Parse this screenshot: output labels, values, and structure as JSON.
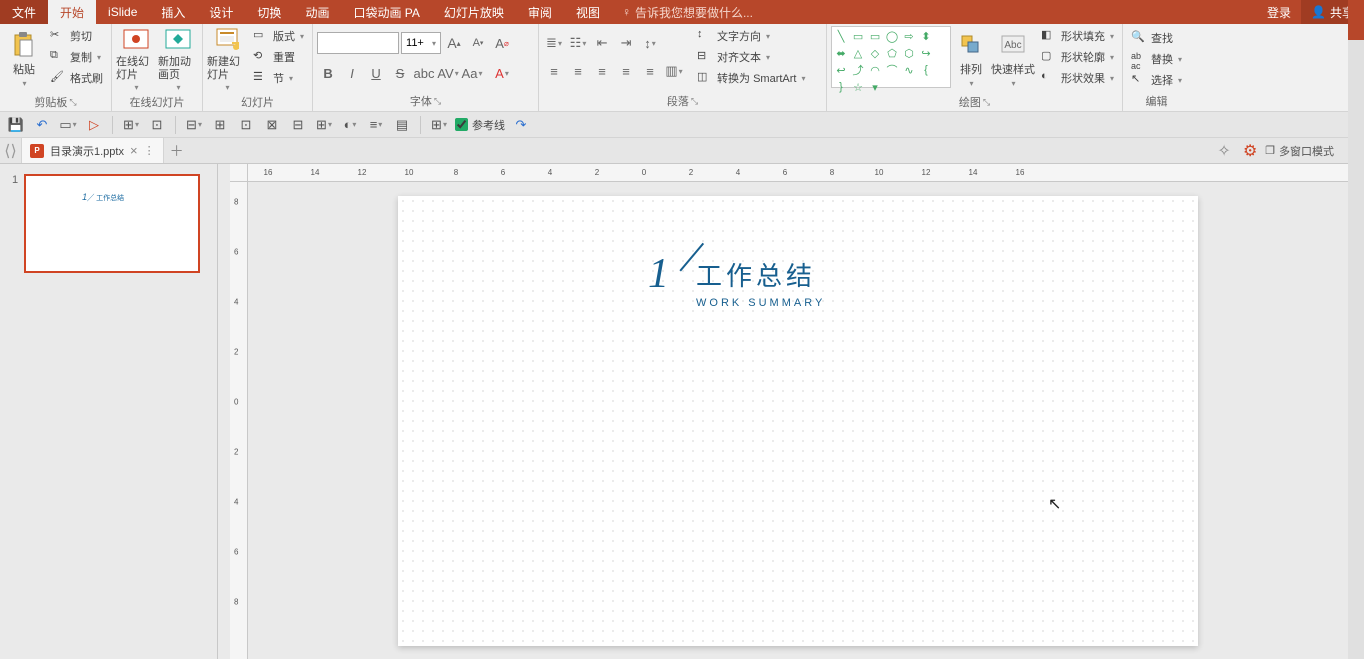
{
  "tabs": {
    "file": "文件",
    "home": "开始",
    "islide": "iSlide",
    "insert": "插入",
    "design": "设计",
    "transition": "切换",
    "animation": "动画",
    "pocket": "口袋动画 PA",
    "slideshow": "幻灯片放映",
    "review": "审阅",
    "view": "视图"
  },
  "tell_me": "告诉我您想要做什么...",
  "title_right": {
    "login": "登录",
    "share": "共享"
  },
  "ribbon": {
    "clipboard": {
      "paste": "粘贴",
      "cut": "剪切",
      "copy": "复制",
      "format_painter": "格式刷",
      "label": "剪贴板"
    },
    "online_slides": {
      "online": "在线幻灯片",
      "new_anim": "新加动画页",
      "label": "在线幻灯片"
    },
    "slides": {
      "new_slide": "新建幻灯片",
      "layout": "版式",
      "reset": "重置",
      "section": "节",
      "label": "幻灯片"
    },
    "font": {
      "size_value": "11+",
      "label": "字体"
    },
    "paragraph": {
      "text_direction": "文字方向",
      "align_text": "对齐文本",
      "smartart": "转换为 SmartArt",
      "label": "段落"
    },
    "drawing": {
      "arrange": "排列",
      "quick_styles": "快速样式",
      "shape_fill": "形状填充",
      "shape_outline": "形状轮廓",
      "shape_effects": "形状效果",
      "label": "绘图"
    },
    "editing": {
      "find": "查找",
      "replace": "替换",
      "select": "选择",
      "label": "编辑"
    }
  },
  "qat": {
    "guides": "参考线"
  },
  "doc": {
    "filename": "目录演示1.pptx"
  },
  "doc_right": {
    "multiwindow": "多窗口模式"
  },
  "thumbs": {
    "num": "1"
  },
  "slide": {
    "num": "1",
    "title": "工作总结",
    "subtitle": "WORK SUMMARY"
  },
  "ruler_h": [
    "16",
    "14",
    "12",
    "10",
    "8",
    "6",
    "4",
    "2",
    "0",
    "2",
    "4",
    "6",
    "8",
    "10",
    "12",
    "14",
    "16"
  ],
  "ruler_v": [
    "8",
    "6",
    "4",
    "2",
    "0",
    "2",
    "4",
    "6",
    "8"
  ]
}
